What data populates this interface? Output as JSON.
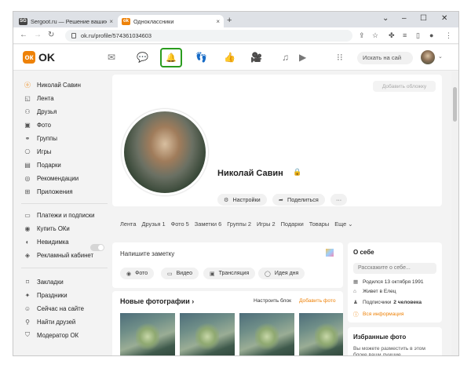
{
  "browser": {
    "tabs": [
      {
        "title": "Sergoot.ru — Решение ваших п",
        "favicon": "SG"
      },
      {
        "title": "Одноклассники",
        "favicon": "ok"
      }
    ],
    "url": "ok.ru/profile/574361034603"
  },
  "header": {
    "logo": "OK",
    "search_placeholder": "Искать на сай"
  },
  "sidebar": {
    "items": [
      {
        "label": "Николай Савин",
        "icon": "ok-icon"
      },
      {
        "label": "Лента",
        "icon": "feed-icon"
      },
      {
        "label": "Друзья",
        "icon": "friends-icon"
      },
      {
        "label": "Фото",
        "icon": "photo-icon"
      },
      {
        "label": "Группы",
        "icon": "groups-icon"
      },
      {
        "label": "Игры",
        "icon": "games-icon"
      },
      {
        "label": "Подарки",
        "icon": "gift-icon"
      },
      {
        "label": "Рекомендации",
        "icon": "recommend-icon"
      },
      {
        "label": "Приложения",
        "icon": "apps-icon"
      },
      {
        "label": "Платежи и подписки",
        "icon": "wallet-icon"
      },
      {
        "label": "Купить ОКи",
        "icon": "coin-icon"
      },
      {
        "label": "Невидимка",
        "icon": "invisible-icon"
      },
      {
        "label": "Рекламный кабинет",
        "icon": "ads-icon"
      },
      {
        "label": "Закладки",
        "icon": "bookmark-icon"
      },
      {
        "label": "Праздники",
        "icon": "holiday-icon"
      },
      {
        "label": "Сейчас на сайте",
        "icon": "online-icon"
      },
      {
        "label": "Найти друзей",
        "icon": "find-icon"
      },
      {
        "label": "Модератор ОК",
        "icon": "shield-icon"
      }
    ]
  },
  "profile": {
    "add_cover": "Добавить обложку",
    "name": "Николай Савин",
    "settings": "Настройки",
    "share": "Поделиться",
    "more": "···",
    "nav": [
      "Лента",
      "Друзья 1",
      "Фото 5",
      "Заметки 6",
      "Группы 2",
      "Игры 2",
      "Подарки",
      "Товары",
      "Еще"
    ]
  },
  "note": {
    "placeholder": "Напишите заметку",
    "buttons": [
      "Фото",
      "Видео",
      "Трансляция",
      "Идея дня"
    ]
  },
  "photos": {
    "title": "Новые фотографии",
    "configure": "Настроить блок",
    "add": "Добавить фото"
  },
  "about": {
    "title": "О себе",
    "input_placeholder": "Расскажите о себе...",
    "born": "Родился 13 октября 1991",
    "lives": "Живет в Елец",
    "subscribers_label": "Подписчики",
    "subscribers_value": "2 человека",
    "all_info": "Вся информация"
  },
  "favorite_photo": {
    "title": "Избранные фото",
    "text": "Вы можете разместить в этом блоке ваши лучшие фотографии, чтобы сделать"
  }
}
